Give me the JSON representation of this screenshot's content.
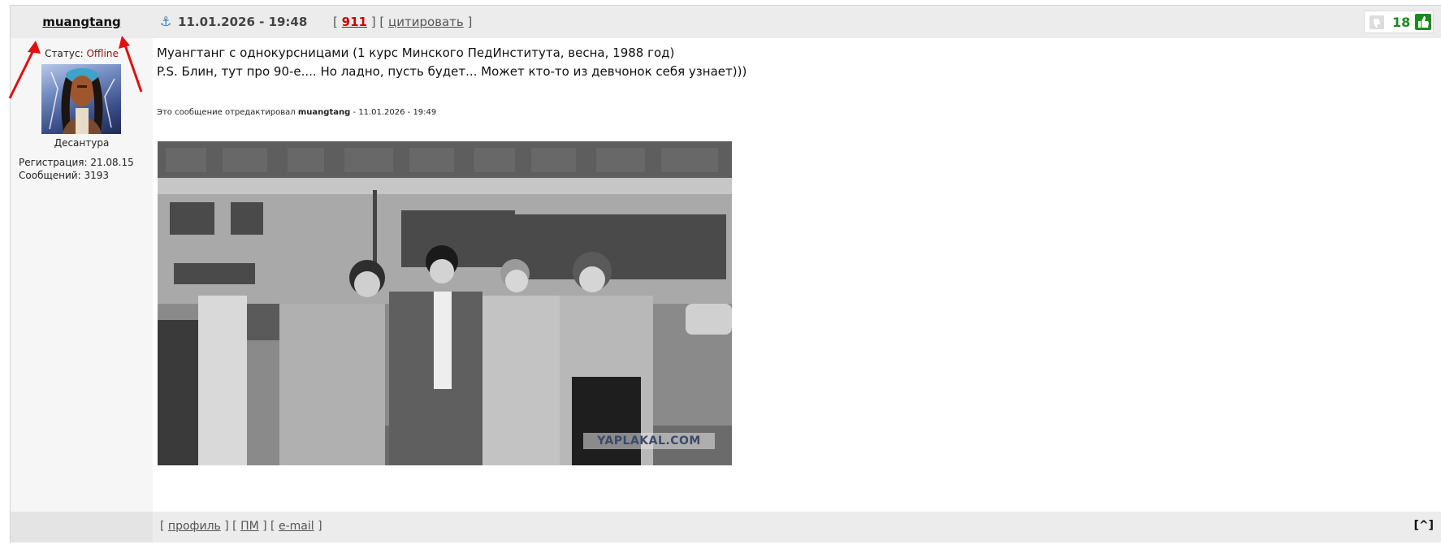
{
  "post": {
    "author": "muangtang",
    "date": "11.01.2026 - 19:48",
    "meta": {
      "bracket_open": "[",
      "number": "911",
      "bracket_mid": "] [",
      "quote_label": "цитировать",
      "bracket_close": "]"
    },
    "rating": "18",
    "user": {
      "status_label": "Статус:",
      "status_value": "Offline",
      "title": "Десантура",
      "registration": "Регистрация: 21.08.15",
      "messages": "Сообщений: 3193"
    },
    "body": {
      "line1": "Муангтанг с однокурсницами (1 курс Минского ПедИнститута, весна, 1988 год)",
      "line2": "P.S. Блин, тут про 90-е.... Но ладно, пусть будет... Может кто-то из девчонок себя узнает)))",
      "edit_prefix": "Это сообщение отредактировал",
      "edit_user": "muangtang",
      "edit_time": "- 11.01.2026 - 19:49"
    },
    "photo_watermark": "YAPLAKAL.COM",
    "footer": {
      "open": "[",
      "profile": "профиль",
      "sep1": "] [",
      "pm": "ПМ",
      "sep2": "] [",
      "email": "e-mail",
      "close": "]",
      "top": "[^]"
    }
  },
  "colors": {
    "header_bg": "#ececec",
    "rating_green": "#1e8a1e",
    "post_number_red": "#c00000",
    "offline_red": "#9b1111",
    "arrow_red": "#e01010"
  }
}
